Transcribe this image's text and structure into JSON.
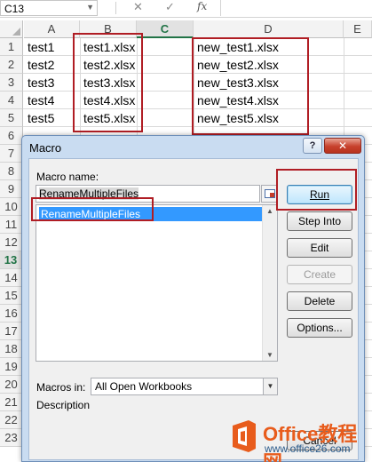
{
  "formula_bar": {
    "cell_ref": "C13",
    "cancel_glyph": "✕",
    "enter_glyph": "✓",
    "fx_label": "fx",
    "formula": ""
  },
  "sheet": {
    "columns": [
      "A",
      "B",
      "C",
      "D",
      "E"
    ],
    "active_column": "C",
    "rows": [
      "1",
      "2",
      "3",
      "4",
      "5",
      "6",
      "7",
      "8",
      "9",
      "10",
      "11",
      "12",
      "13",
      "14",
      "15",
      "16",
      "17",
      "18",
      "19",
      "20",
      "21",
      "22",
      "23"
    ],
    "active_row": "13",
    "cells": {
      "A": [
        "test1",
        "test2",
        "test3",
        "test4",
        "test5"
      ],
      "B": [
        "test1.xlsx",
        "test2.xlsx",
        "test3.xlsx",
        "test4.xlsx",
        "test5.xlsx"
      ],
      "D": [
        "new_test1.xlsx",
        "new_test2.xlsx",
        "new_test3.xlsx",
        "new_test4.xlsx",
        "new_test5.xlsx"
      ]
    }
  },
  "dialog": {
    "title": "Macro",
    "help_glyph": "?",
    "close_glyph": "✕",
    "macro_name_label": "Macro name:",
    "macro_name_value": "RenameMultipleFiles",
    "macro_list": [
      "RenameMultipleFiles"
    ],
    "buttons": {
      "run": "Run",
      "step_into": "Step Into",
      "edit": "Edit",
      "create": "Create",
      "delete": "Delete",
      "options": "Options...",
      "cancel": "Cancel"
    },
    "macros_in_label": "Macros in:",
    "macros_in_value": "All Open Workbooks",
    "description_label": "Description"
  },
  "watermark": {
    "brand": "Office教程网",
    "url": "www.office26.com"
  },
  "colors": {
    "excel_green": "#217346",
    "highlight_red": "#b01d24",
    "list_selection": "#3399ff",
    "brand_orange": "#e85c1c"
  }
}
